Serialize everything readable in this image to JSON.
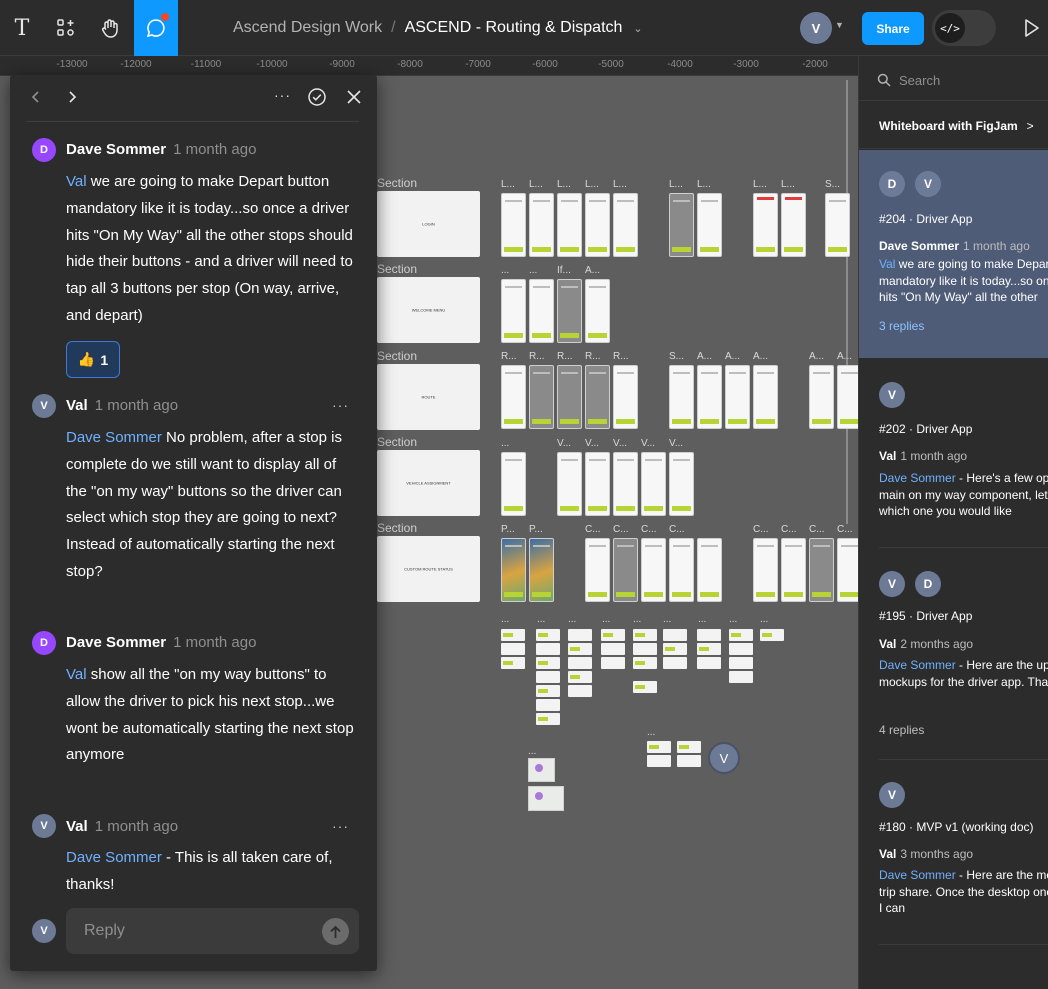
{
  "toolbar": {
    "tools": [
      {
        "name": "text-tool",
        "glyph": "T"
      },
      {
        "name": "components-tool"
      },
      {
        "name": "hand-tool"
      },
      {
        "name": "comment-tool",
        "active": true
      }
    ],
    "breadcrumb": {
      "team": "Ascend Design Work",
      "separator": "/",
      "file": "ASCEND - Routing & Dispatch"
    },
    "current_user_initial": "V",
    "share_label": "Share",
    "dev_mode_glyph": "</>",
    "accent_color": "#0d99ff"
  },
  "ruler": {
    "ticks": [
      "-13000",
      "-12000",
      "-11000",
      "-10000",
      "-9000",
      "-8000",
      "-7000",
      "-6000",
      "-5000",
      "-4000",
      "-3000",
      "-2000"
    ]
  },
  "canvas": {
    "sections": [
      {
        "label": "Section",
        "title": "LOGIN"
      },
      {
        "label": "Section",
        "title": "WELCOME MENU"
      },
      {
        "label": "Section",
        "title": "ROUTE"
      },
      {
        "label": "Section",
        "title": "VEHICLE ASSIGNMENT"
      },
      {
        "label": "Section",
        "title": "CUSTOM ROUTE STATUS"
      }
    ],
    "frame_labels": {
      "row1": [
        "L...",
        "L...",
        "L...",
        "L...",
        "L...",
        "L...",
        "L...",
        "L...",
        "L...",
        "S..."
      ],
      "row2": [
        "...",
        "...",
        "If...",
        "A..."
      ],
      "row3": [
        "R...",
        "R...",
        "R...",
        "R...",
        "R...",
        "S...",
        "A...",
        "A...",
        "A...",
        "A...",
        "A..."
      ],
      "row4": [
        "...",
        "V...",
        "V...",
        "V...",
        "V...",
        "V..."
      ],
      "row5": [
        "P...",
        "P...",
        "C...",
        "C...",
        "C...",
        "C...",
        "C...",
        "C...",
        "C...",
        "C..."
      ],
      "small": "..."
    },
    "collaborator_initial": "V"
  },
  "thread": {
    "comments": [
      {
        "initial": "D",
        "author": "Dave Sommer",
        "time": "1 month ago",
        "mention": "Val",
        "text": " we are going to make Depart button mandatory like it is today...so once a driver hits \"On My Way\" all the other stops should hide their buttons - and a driver will need to tap all 3 buttons per stop (On way, arrive, and depart)",
        "reaction": {
          "emoji": "👍",
          "count": "1"
        }
      },
      {
        "initial": "V",
        "author": "Val",
        "time": "1 month ago",
        "mention": "Dave Sommer",
        "text": " No problem, after a stop is complete do we still want to display all of the \"on my way\" buttons so the driver can select which stop they are going to next? Instead of automatically starting the next stop?"
      },
      {
        "initial": "D",
        "author": "Dave Sommer",
        "time": "1 month ago",
        "mention": "Val",
        "text": " show all the \"on my way buttons\" to allow the driver to pick his next stop...we wont be automatically starting the next stop anymore"
      },
      {
        "initial": "V",
        "author": "Val",
        "time": "1 month ago",
        "mention": "Dave Sommer",
        "text": " - This is all taken care of, thanks!"
      }
    ],
    "more_glyph": "···",
    "reply": {
      "initial": "V",
      "placeholder": "Reply"
    }
  },
  "right_panel": {
    "search_placeholder": "Search",
    "promo": "Whiteboard with FigJam",
    "threads": [
      {
        "avatars": [
          "D",
          "V"
        ],
        "title": "#204 · Driver App",
        "author": "Dave Sommer",
        "time": "1 month ago",
        "mention": "Val",
        "excerpt": " we are going to make Depart button mandatory like it is today...so once a driver hits \"On My Way\" all the other",
        "replies": "3 replies",
        "selected": true
      },
      {
        "avatars": [
          "V"
        ],
        "title": "#202 · Driver App",
        "author": "Val",
        "time": "1 month ago",
        "mention": "Dave Sommer",
        "excerpt": " - Here's a few options for the main on my way component, let me know which one you would like",
        "replies": ""
      },
      {
        "avatars": [
          "V",
          "D"
        ],
        "title": "#195 · Driver App",
        "author": "Val",
        "time": "2 months ago",
        "mention": "Dave Sommer",
        "excerpt": " - Here are the updated mockups for the driver app. Thanks!",
        "replies": "4 replies"
      },
      {
        "avatars": [
          "V"
        ],
        "title": "#180 · MVP v1 (working doc)",
        "author": "Val",
        "time": "3 months ago",
        "mention": "Dave Sommer",
        "excerpt": " - Here are the mockups for trip share. Once the desktop ones look good I can",
        "replies": ""
      }
    ]
  }
}
